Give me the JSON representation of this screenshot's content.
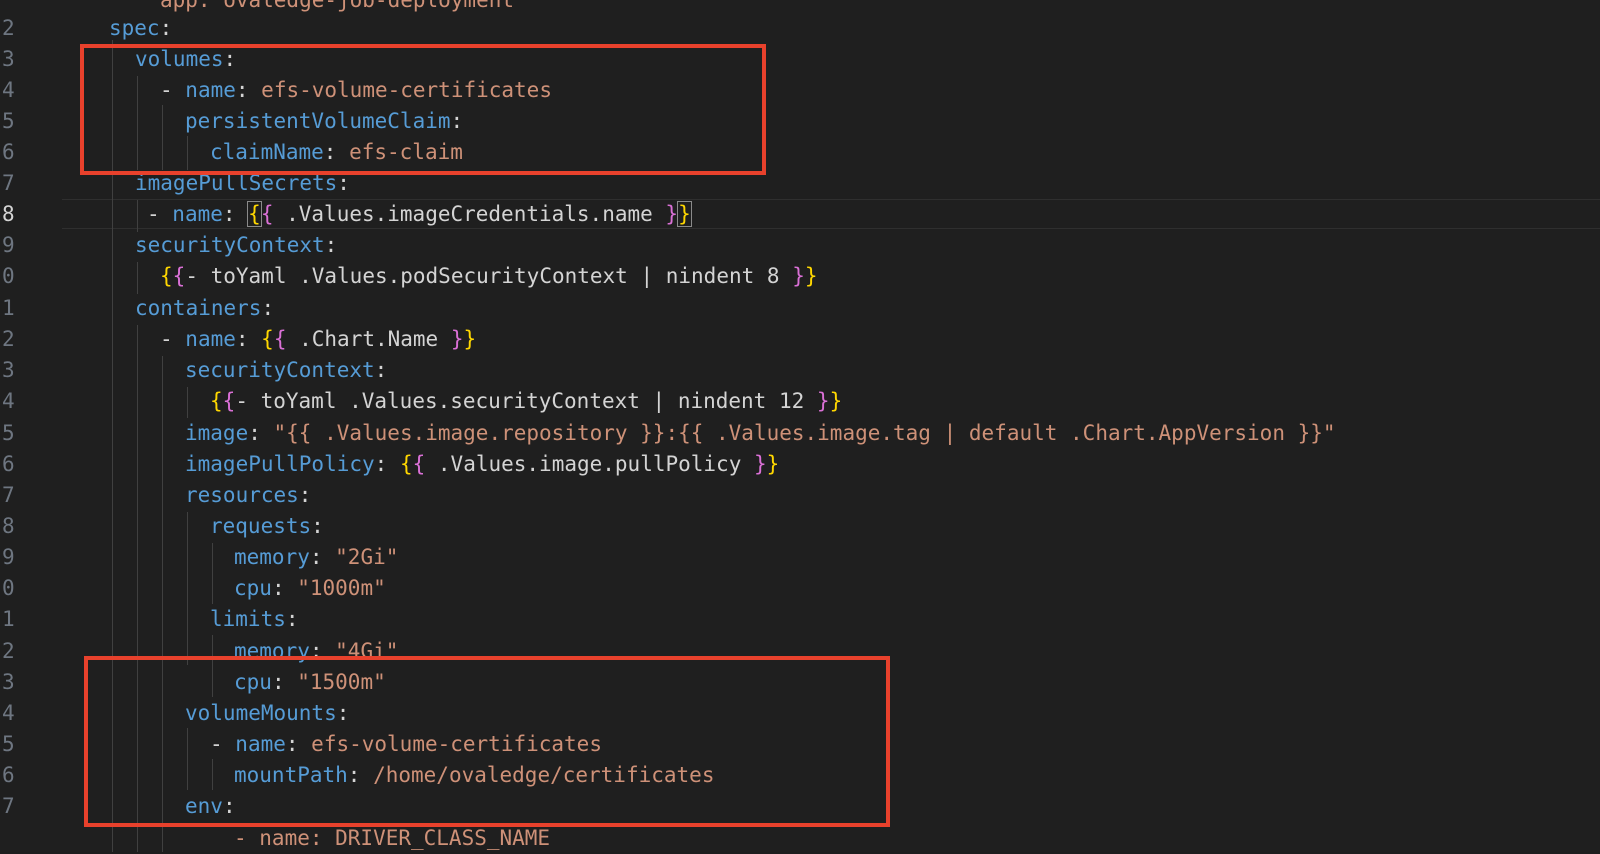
{
  "editor": {
    "lines": [
      {
        "num": "",
        "segments": [
          {
            "text": "app: ovaledge-job-deployment",
            "kind": "v"
          }
        ]
      },
      {
        "num": "2",
        "segments": [
          {
            "text": "spec",
            "kind": "k"
          },
          {
            "text": ":",
            "kind": "p"
          }
        ]
      },
      {
        "num": "3",
        "segments": [
          {
            "text": "volumes",
            "kind": "k"
          },
          {
            "text": ":",
            "kind": "p"
          }
        ]
      },
      {
        "num": "4",
        "segments": [
          {
            "text": "- ",
            "kind": "p"
          },
          {
            "text": "name",
            "kind": "k"
          },
          {
            "text": ": ",
            "kind": "p"
          },
          {
            "text": "efs-volume-certificates",
            "kind": "v"
          }
        ]
      },
      {
        "num": "5",
        "segments": [
          {
            "text": "persistentVolumeClaim",
            "kind": "k"
          },
          {
            "text": ":",
            "kind": "p"
          }
        ]
      },
      {
        "num": "6",
        "segments": [
          {
            "text": "claimName",
            "kind": "k"
          },
          {
            "text": ": ",
            "kind": "p"
          },
          {
            "text": "efs-claim",
            "kind": "v"
          }
        ]
      },
      {
        "num": "7",
        "segments": [
          {
            "text": "imagePullSecrets",
            "kind": "k"
          },
          {
            "text": ":",
            "kind": "p"
          }
        ]
      },
      {
        "num": "8",
        "segments": [
          {
            "text": "- ",
            "kind": "p"
          },
          {
            "text": "name",
            "kind": "k"
          },
          {
            "text": ": ",
            "kind": "p"
          },
          {
            "text": "{",
            "kind": "b1",
            "boxed": true
          },
          {
            "text": "{",
            "kind": "b2"
          },
          {
            "text": " .Values.imageCredentials.name ",
            "kind": "t"
          },
          {
            "text": "}",
            "kind": "b2"
          },
          {
            "text": "}",
            "kind": "b1",
            "boxed": true
          }
        ]
      },
      {
        "num": "9",
        "segments": [
          {
            "text": "securityContext",
            "kind": "k"
          },
          {
            "text": ":",
            "kind": "p"
          }
        ]
      },
      {
        "num": "0",
        "segments": [
          {
            "text": "{",
            "kind": "b1"
          },
          {
            "text": "{",
            "kind": "b2"
          },
          {
            "text": "- toYaml .Values.podSecurityContext | nindent 8 ",
            "kind": "t"
          },
          {
            "text": "}",
            "kind": "b2"
          },
          {
            "text": "}",
            "kind": "b1"
          }
        ]
      },
      {
        "num": "1",
        "segments": [
          {
            "text": "containers",
            "kind": "k"
          },
          {
            "text": ":",
            "kind": "p"
          }
        ]
      },
      {
        "num": "2",
        "segments": [
          {
            "text": "- ",
            "kind": "p"
          },
          {
            "text": "name",
            "kind": "k"
          },
          {
            "text": ": ",
            "kind": "p"
          },
          {
            "text": "{",
            "kind": "b1"
          },
          {
            "text": "{",
            "kind": "b2"
          },
          {
            "text": " .Chart.Name ",
            "kind": "t"
          },
          {
            "text": "}",
            "kind": "b2"
          },
          {
            "text": "}",
            "kind": "b1"
          }
        ]
      },
      {
        "num": "3",
        "segments": [
          {
            "text": "securityContext",
            "kind": "k"
          },
          {
            "text": ":",
            "kind": "p"
          }
        ]
      },
      {
        "num": "4",
        "segments": [
          {
            "text": "{",
            "kind": "b1"
          },
          {
            "text": "{",
            "kind": "b2"
          },
          {
            "text": "- toYaml .Values.securityContext | nindent 12 ",
            "kind": "t"
          },
          {
            "text": "}",
            "kind": "b2"
          },
          {
            "text": "}",
            "kind": "b1"
          }
        ]
      },
      {
        "num": "5",
        "segments": [
          {
            "text": "image",
            "kind": "k"
          },
          {
            "text": ": ",
            "kind": "p"
          },
          {
            "text": "\"{{ .Values.image.repository }}:{{ .Values.image.tag | default .Chart.AppVersion }}\"",
            "kind": "v"
          }
        ]
      },
      {
        "num": "6",
        "segments": [
          {
            "text": "imagePullPolicy",
            "kind": "k"
          },
          {
            "text": ": ",
            "kind": "p"
          },
          {
            "text": "{",
            "kind": "b1"
          },
          {
            "text": "{",
            "kind": "b2"
          },
          {
            "text": " .Values.image.pullPolicy ",
            "kind": "t"
          },
          {
            "text": "}",
            "kind": "b2"
          },
          {
            "text": "}",
            "kind": "b1"
          }
        ]
      },
      {
        "num": "7",
        "segments": [
          {
            "text": "resources",
            "kind": "k"
          },
          {
            "text": ":",
            "kind": "p"
          }
        ]
      },
      {
        "num": "8",
        "segments": [
          {
            "text": "requests",
            "kind": "k"
          },
          {
            "text": ":",
            "kind": "p"
          }
        ]
      },
      {
        "num": "9",
        "segments": [
          {
            "text": "memory",
            "kind": "k"
          },
          {
            "text": ": ",
            "kind": "p"
          },
          {
            "text": "\"2Gi\"",
            "kind": "v"
          }
        ]
      },
      {
        "num": "0",
        "segments": [
          {
            "text": "cpu",
            "kind": "k"
          },
          {
            "text": ": ",
            "kind": "p"
          },
          {
            "text": "\"1000m\"",
            "kind": "v"
          }
        ]
      },
      {
        "num": "1",
        "segments": [
          {
            "text": "limits",
            "kind": "k"
          },
          {
            "text": ":",
            "kind": "p"
          }
        ]
      },
      {
        "num": "2",
        "segments": [
          {
            "text": "memory",
            "kind": "k"
          },
          {
            "text": ": ",
            "kind": "p"
          },
          {
            "text": "\"4Gi\"",
            "kind": "v"
          }
        ]
      },
      {
        "num": "3",
        "segments": [
          {
            "text": "cpu",
            "kind": "k"
          },
          {
            "text": ": ",
            "kind": "p"
          },
          {
            "text": "\"1500m\"",
            "kind": "v"
          }
        ]
      },
      {
        "num": "4",
        "segments": [
          {
            "text": "volumeMounts",
            "kind": "k"
          },
          {
            "text": ":",
            "kind": "p"
          }
        ]
      },
      {
        "num": "5",
        "segments": [
          {
            "text": "- ",
            "kind": "p"
          },
          {
            "text": "name",
            "kind": "k"
          },
          {
            "text": ": ",
            "kind": "p"
          },
          {
            "text": "efs-volume-certificates",
            "kind": "v"
          }
        ]
      },
      {
        "num": "6",
        "segments": [
          {
            "text": "mountPath",
            "kind": "k"
          },
          {
            "text": ": ",
            "kind": "p"
          },
          {
            "text": "/home/ovaledge/certificates",
            "kind": "v"
          }
        ]
      },
      {
        "num": "7",
        "segments": [
          {
            "text": "env",
            "kind": "k"
          },
          {
            "text": ":",
            "kind": "p"
          }
        ]
      },
      {
        "num": "",
        "segments": [
          {
            "text": "- name: DRIVER_CLASS_NAME",
            "kind": "v"
          }
        ]
      }
    ],
    "colors": {
      "background": "#1f1f1f",
      "key": "#569cd6",
      "value": "#ce9178",
      "bracket_outer": "#ffd700",
      "bracket_inner": "#da70d6",
      "annotation_box": "#e8412c"
    }
  }
}
